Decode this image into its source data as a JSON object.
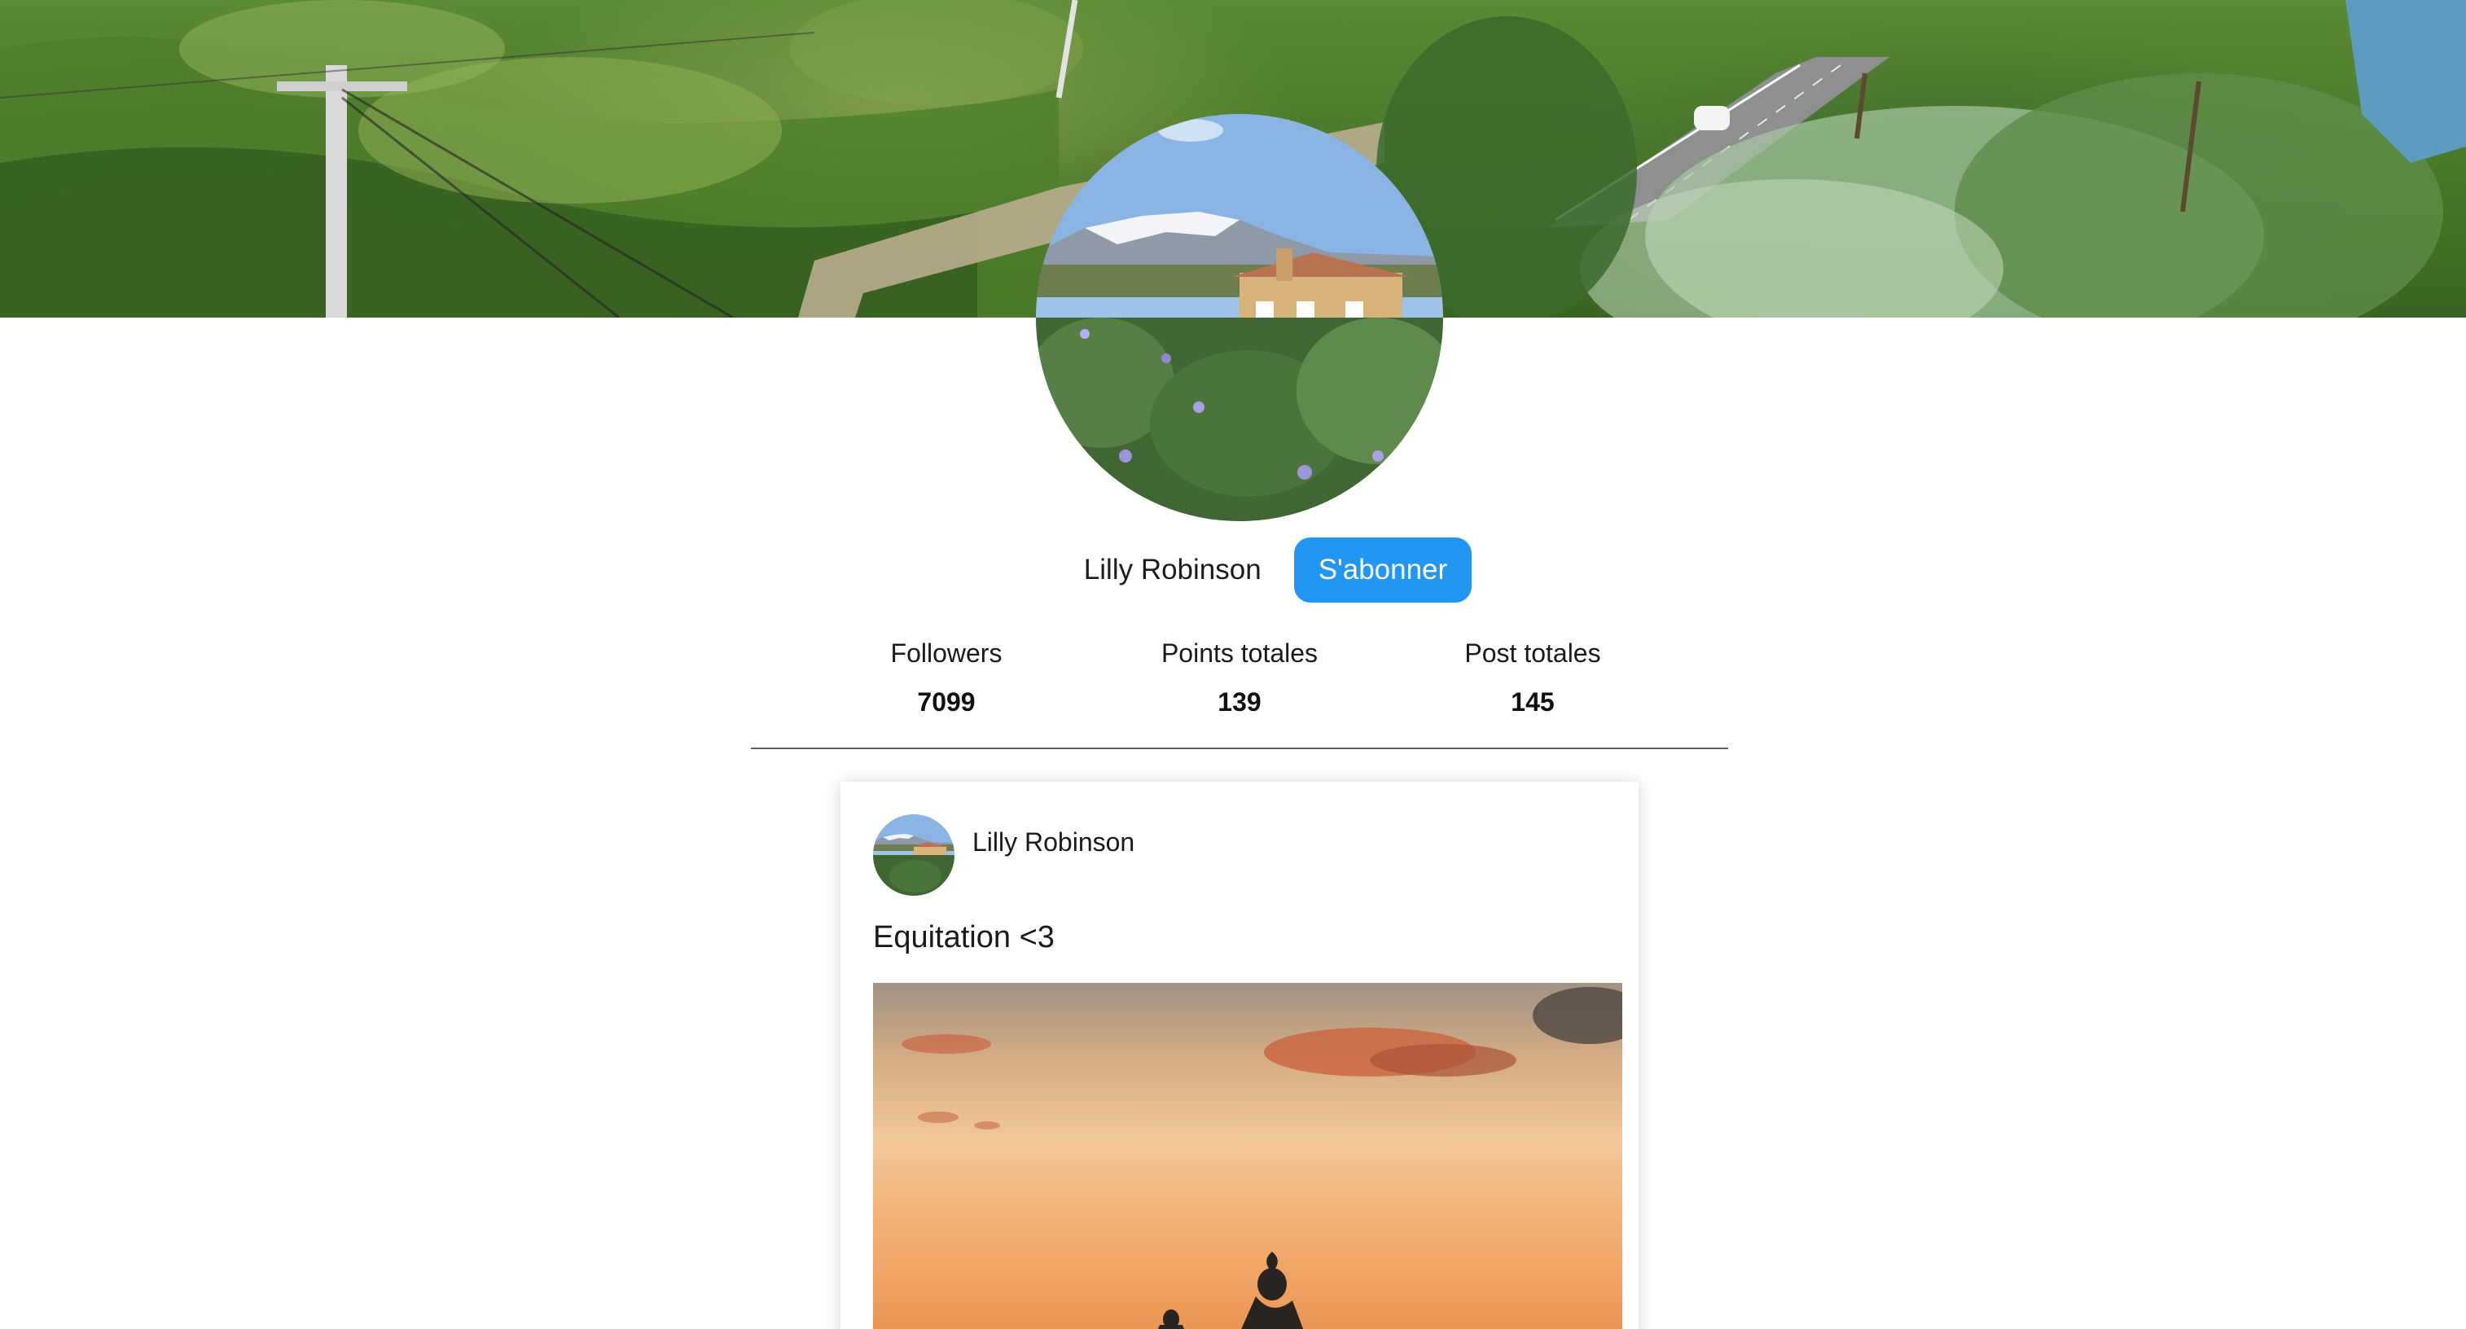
{
  "profile": {
    "name": "Lilly Robinson",
    "subscribe_label": "S'abonner"
  },
  "stats": [
    {
      "label": "Followers",
      "value": "7099"
    },
    {
      "label": "Points totales",
      "value": "139"
    },
    {
      "label": "Post totales",
      "value": "145"
    }
  ],
  "post": {
    "author": "Lilly Robinson",
    "text": "Equitation <3"
  },
  "colors": {
    "accent": "#2196f3",
    "divider": "#606060"
  }
}
